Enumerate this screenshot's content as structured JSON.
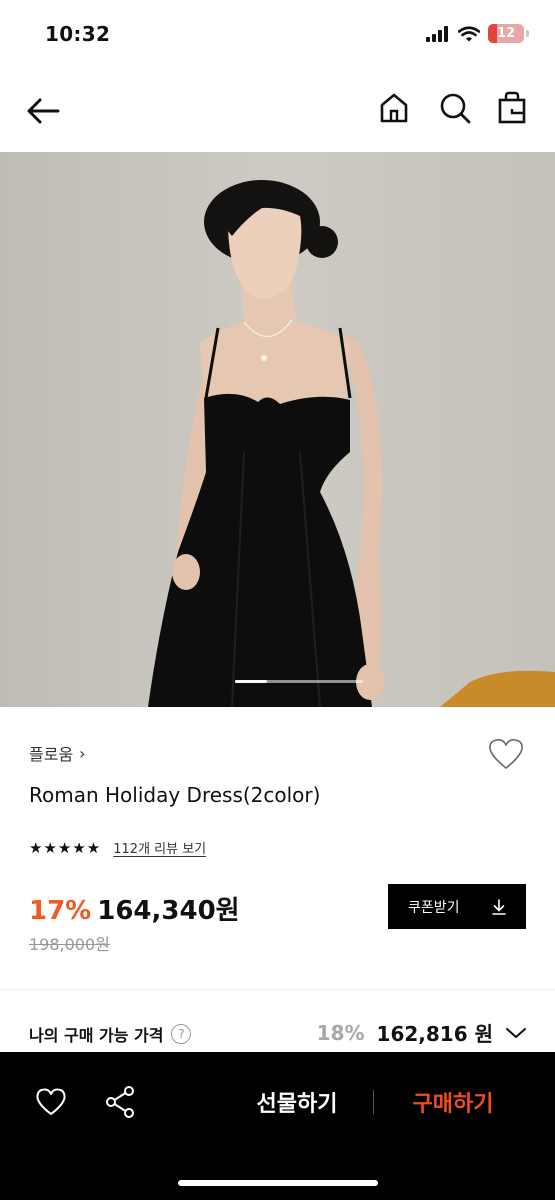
{
  "status_bar": {
    "time": "10:32",
    "battery": "12"
  },
  "product": {
    "brand": "플로움",
    "brand_chevron": "›",
    "name": "Roman Holiday Dress(2color)",
    "stars": "★★★★★",
    "review_link": "112개 리뷰 보기",
    "discount": "17%",
    "price": "164,340원",
    "original_price": "198,000원"
  },
  "coupon": {
    "label": "쿠폰받기"
  },
  "my_price": {
    "label": "나의 구매 가능 가격",
    "help": "?",
    "discount": "18%",
    "price": "162,816 원"
  },
  "bottom_bar": {
    "gift": "선물하기",
    "buy": "구매하기"
  },
  "colors": {
    "accent": "#f05a22",
    "buy": "#f04c23",
    "bar": "#000000"
  },
  "icons": [
    "back-arrow-icon",
    "home-icon",
    "search-icon",
    "shopping-bag-icon",
    "heart-icon",
    "share-icon",
    "download-icon",
    "chevron-down-icon",
    "help-icon",
    "cellular-icon",
    "wifi-icon",
    "battery-icon"
  ]
}
